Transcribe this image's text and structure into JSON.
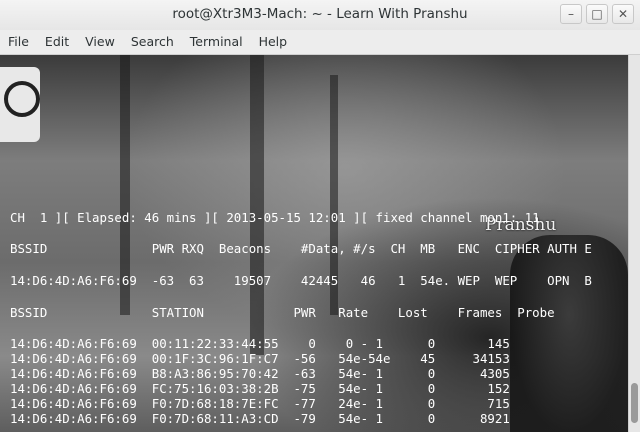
{
  "window": {
    "title": "root@Xtr3M3-Mach: ~ - Learn With Pranshu",
    "buttons": [
      "minimize",
      "maximize",
      "close"
    ]
  },
  "menubar": {
    "items": [
      "File",
      "Edit",
      "View",
      "Search",
      "Terminal",
      "Help"
    ]
  },
  "terminal": {
    "watermark": "Pranshu",
    "lines": [
      "CH  1 ][ Elapsed: 46 mins ][ 2013-05-15 12:01 ][ fixed channel mon1: 11",
      "BSSID              PWR RXQ  Beacons    #Data, #/s  CH  MB   ENC  CIPHER AUTH E",
      "14:D6:4D:A6:F6:69  -63  63    19507    42445   46   1  54e. WEP  WEP    OPN  B",
      "BSSID              STATION            PWR   Rate    Lost    Frames  Probe",
      "14:D6:4D:A6:F6:69  00:11:22:33:44:55    0    0 - 1      0       145",
      "14:D6:4D:A6:F6:69  00:1F:3C:96:1F:C7  -56   54e-54e    45     34153",
      "14:D6:4D:A6:F6:69  B8:A3:86:95:70:42  -63   54e- 1      0      4305",
      "14:D6:4D:A6:F6:69  FC:75:16:03:38:2B  -75   54e- 1      0       152",
      "14:D6:4D:A6:F6:69  F0:7D:68:18:7E:FC  -77   24e- 1      0       715",
      "14:D6:4D:A6:F6:69  F0:7D:68:11:A3:CD  -79   54e- 1      0      8921"
    ]
  }
}
